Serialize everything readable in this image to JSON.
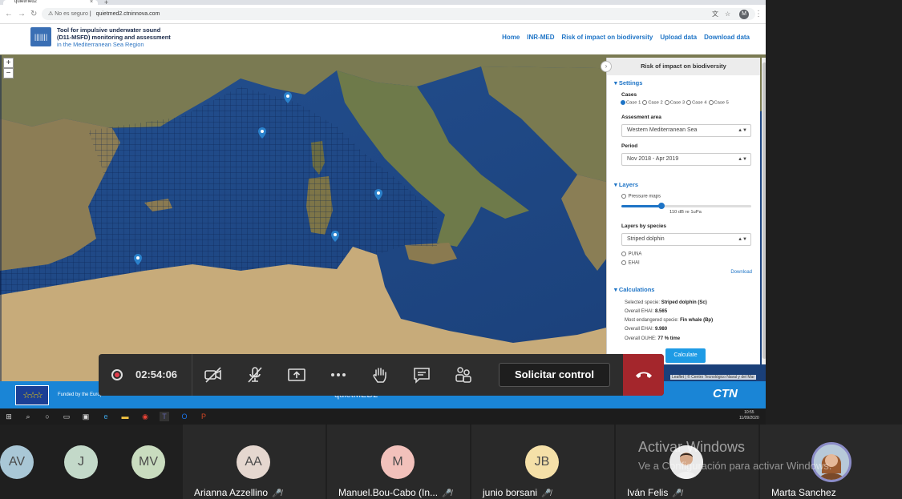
{
  "browser": {
    "tab_title": "quietmed2",
    "security": "No es seguro",
    "url": "quietmed2.ctninnova.com",
    "profile_initial": "M"
  },
  "site": {
    "logo_text": "|||||||",
    "title_line1": "Tool for impulsive underwater sound",
    "title_line2": "(D11-MSFD) monitoring and assessment",
    "title_line3": "in the Mediterranean Sea Region",
    "nav": [
      "Home",
      "INR-MED",
      "Risk of impact on biodiversity",
      "Upload data",
      "Download data"
    ]
  },
  "map": {
    "zoom_in": "+",
    "zoom_out": "−",
    "attribution": "Leaflet | © Centro Tecnológico Naval y del Mar",
    "pin_count": 6
  },
  "panel": {
    "title": "Risk of impact on biodiversity",
    "settings": {
      "header": "▾ Settings",
      "cases_label": "Cases",
      "cases": [
        "Case 1",
        "Case 2",
        "Case 3",
        "Case 4",
        "Case 5"
      ],
      "assessment_label": "Assesment area",
      "assessment_value": "Western Mediterranean Sea",
      "period_label": "Period",
      "period_value": "Nov 2018 - Apr 2019"
    },
    "layers": {
      "header": "▾ Layers",
      "pressure_maps": "Pressure maps",
      "slider_value": "110 dB re 1uPa",
      "slider_fraction": 0.31,
      "by_species_label": "Layers by species",
      "species_value": "Striped dolphin",
      "opt1": "PUNA",
      "opt2": "EHAI",
      "download": "Download"
    },
    "calculations": {
      "header": "▾ Calculations",
      "sel_label": "Selected specie:",
      "sel_value": "Striped dolphin (Sc)",
      "ehai1_label": "Overall EHAI:",
      "ehai1_value": "8.565",
      "most_label": "Most endangered specie:",
      "most_value": "Fin whale (Bp)",
      "ehai2_label": "Overall EHAI:",
      "ehai2_value": "9.980",
      "ouhe_label": "Overall OUHE:",
      "ouhe_value": "77 % time",
      "button": "Calculate"
    }
  },
  "footer": {
    "eu_stars": "☆☆☆",
    "funded": "Funded by the European Union",
    "project": "quietMED2",
    "brand": "CTN"
  },
  "meeting": {
    "timer": "02:54:06",
    "request_control": "Solicitar control"
  },
  "taskbar": {
    "time": "10:55",
    "date": "11/09/2020"
  },
  "participants": [
    {
      "initials": "AV",
      "name": "",
      "color": "#a9c7d6"
    },
    {
      "initials": "J",
      "name": "",
      "color": "#c3d9c9"
    },
    {
      "initials": "MV",
      "name": "",
      "color": "#c9dcbf"
    },
    {
      "initials": "AA",
      "name": "Arianna Azzellino",
      "color": "#e5d7cf"
    },
    {
      "initials": "M",
      "name": "Manuel.Bou-Cabo (In...",
      "color": "#f2c1bb"
    },
    {
      "initials": "JB",
      "name": "junio borsani",
      "color": "#f5e0a8"
    },
    {
      "initials": "",
      "name": "Iván Felis",
      "color": "#d8d8d8"
    },
    {
      "initials": "",
      "name": "Marta Sanchez",
      "color": "#d8d8d8"
    }
  ],
  "watermark": {
    "line1": "Activar Windows",
    "line2": "Ve a Configuración para activar Windows."
  }
}
